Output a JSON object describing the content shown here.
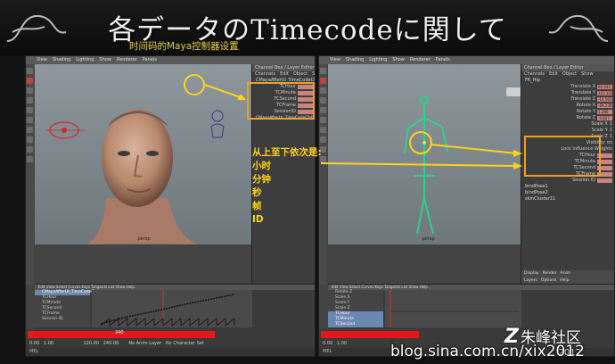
{
  "slide": {
    "title": "各データのTimecodeに関して",
    "subtitle": "时间码的Maya控制器设置"
  },
  "maya": {
    "menu_left": [
      "View",
      "Shading",
      "Lighting",
      "Show",
      "Renderer",
      "Panels"
    ],
    "channel_box_title": "Channel Box / Layer Editor",
    "channel_menu": [
      "Channels",
      "Edit",
      "Object",
      "Show"
    ],
    "left_node": "CMayaAfterUI_TimeCodeCtrl",
    "left_channels": [
      "TCHour",
      "TCMinute",
      "TCSecond",
      "TCFrame",
      "SessionID"
    ],
    "left_shape": "CMayaAfterUI_TimeCodeCtrlShape",
    "right_node": "FK_Hip",
    "right_channels": [
      "Translate X",
      "Translate Y",
      "Translate Z",
      "Rotate X",
      "Rotate Y",
      "Rotate Z",
      "Scale X",
      "Scale Y",
      "Scale Z",
      "Visibility"
    ],
    "right_channels_lower": [
      "Lock Influence Weights",
      "TCHour",
      "TCMinute",
      "TCSecond",
      "TCFrame",
      "Session ID"
    ],
    "right_nodes": [
      "bindPose1",
      "bindPose2",
      "skinCluster11"
    ],
    "right_vals": [
      "95.543",
      "125.122",
      "-14.563",
      "-69.238",
      "1.286",
      "-0.827",
      "1",
      "1",
      "1",
      "on"
    ],
    "outliner_left": [
      "CMayaAfterUI_TimeCodeCtrl",
      "TCHour",
      "TCMinute",
      "TCSecond",
      "TCFrame",
      "Session ID"
    ],
    "outliner_right": [
      "Rotate Z",
      "Scale X",
      "Scale Y",
      "Scale Z",
      "TCHour",
      "TCMinute",
      "TCSecond",
      "TCFrame"
    ],
    "persp_label": "persp",
    "time_end": "240",
    "range": [
      "0.00",
      "1.00",
      "120.00",
      "240.00"
    ],
    "layer_label": "No Anim Layer",
    "char_label": "No Character Set",
    "cmd_label": "MEL",
    "panel_tabs": [
      "Display",
      "Render",
      "Anim"
    ],
    "panel_menu": [
      "Layers",
      "Options",
      "Help"
    ]
  },
  "annotation": {
    "heading": "从上至下依次是:",
    "items": [
      "小时",
      "分钟",
      "秒",
      "帧",
      "ID"
    ]
  },
  "watermark": {
    "url": "blog.sina.com.cn/xix2012",
    "logo_text": "朱峰社区",
    "logo_year": "2012"
  },
  "colors": {
    "highlight": "#f0a020",
    "annotation": "#ffd21a",
    "timeline_red": "#e01818",
    "channel_value": "#c9847e"
  }
}
